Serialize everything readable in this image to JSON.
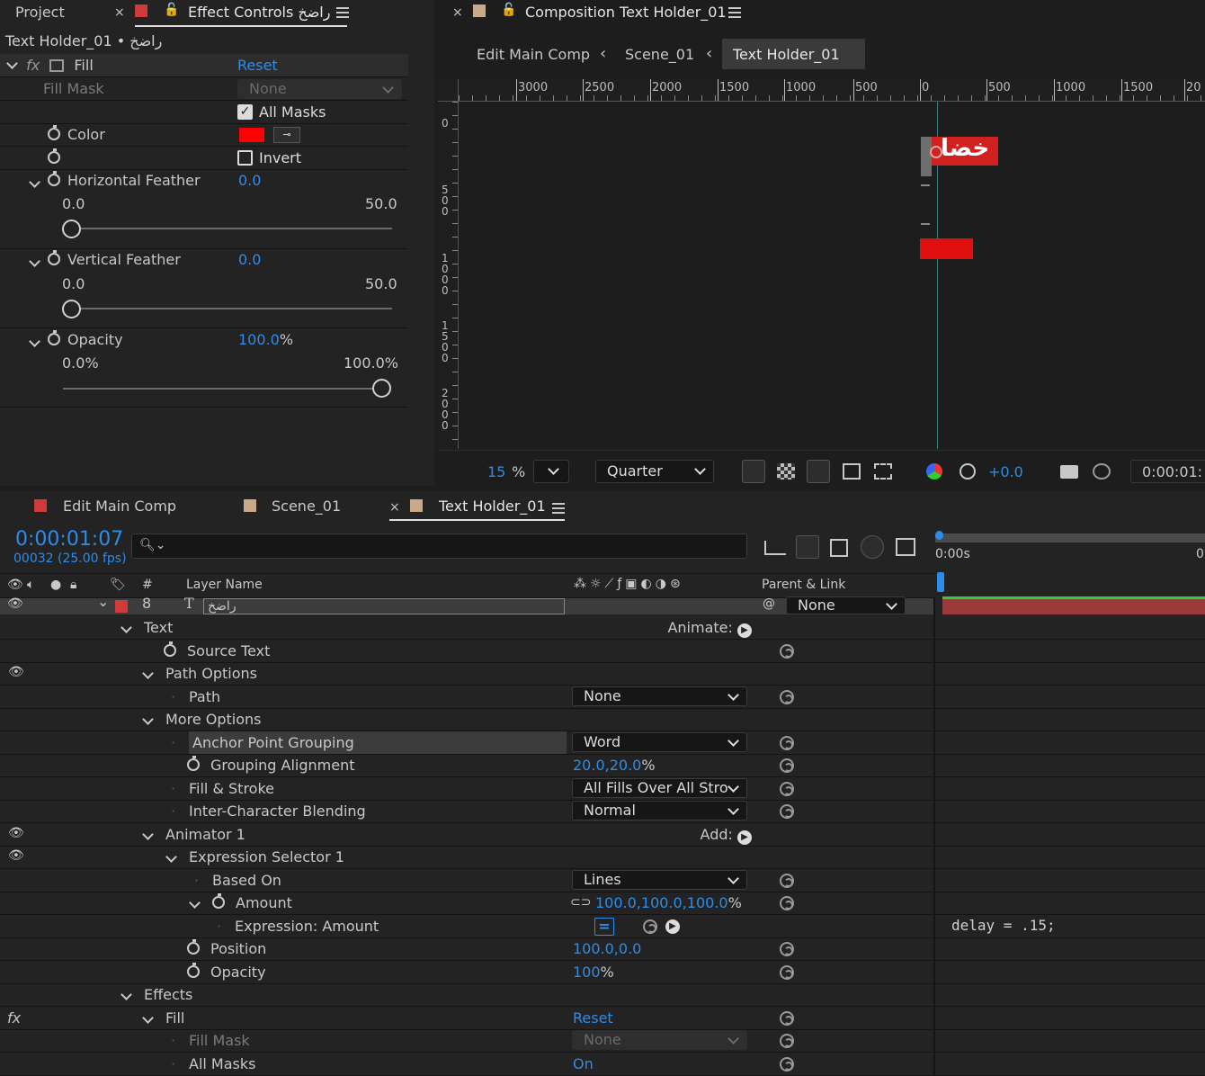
{
  "effect_controls": {
    "tabs": [
      {
        "label": "Project"
      },
      {
        "label": "Effect Controls راضخ"
      }
    ],
    "layer_label": "Text Holder_01 • راضخ",
    "effect": {
      "name": "Fill",
      "reset": "Reset"
    },
    "fill_mask": {
      "label": "Fill Mask",
      "value": "None"
    },
    "all_masks": {
      "label": "All Masks",
      "checked": true
    },
    "color": {
      "label": "Color",
      "value": "#ff0000"
    },
    "invert": {
      "label": "Invert",
      "checked": false
    },
    "horizontal_feather": {
      "label": "Horizontal Feather",
      "value": "0.0",
      "min": "0.0",
      "max": "50.0",
      "level": 0
    },
    "vertical_feather": {
      "label": "Vertical Feather",
      "value": "0.0",
      "min": "0.0",
      "max": "50.0",
      "level": 0
    },
    "opacity": {
      "label": "Opacity",
      "value": "100.0",
      "unit": "%",
      "min": "0.0%",
      "max": "100.0%",
      "level": 1
    }
  },
  "composition": {
    "tab": "Composition Text Holder_01",
    "breadcrumbs": [
      "Edit Main Comp",
      "Scene_01",
      "Text Holder_01"
    ],
    "ruler_h": [
      "3000",
      "2500",
      "2000",
      "1500",
      "1000",
      "500",
      "0",
      "500",
      "1000",
      "1500",
      "20"
    ],
    "ruler_v": [
      "0",
      "500",
      "1000",
      "1500",
      "2000"
    ],
    "zoom": "15",
    "zoom_unit": "%",
    "resolution": "Quarter",
    "exposure": "+0.0",
    "timecode": "0:00:01:",
    "canvas_text": "خضا"
  },
  "timeline": {
    "tabs": [
      {
        "label": "Edit Main Comp",
        "color": "#d03a3a"
      },
      {
        "label": "Scene_01",
        "color": "#c8a98a"
      },
      {
        "label": "Text Holder_01",
        "color": "#c8a98a"
      }
    ],
    "timecode": "0:00:01:07",
    "frame_info": "00032 (25.00 fps)",
    "columns": {
      "num": "#",
      "layer_name": "Layer Name",
      "parent": "Parent & Link"
    },
    "layer": {
      "number": "8",
      "name": "راضخ",
      "parent": "None"
    },
    "ruler_start": "0:00s",
    "ruler_end": "0",
    "expression_text": "delay = .15;",
    "rows": [
      {
        "label": "Text",
        "right": "Animate:"
      },
      {
        "label": "Source Text"
      },
      {
        "label": "Path Options"
      },
      {
        "label": "Path",
        "dd": "None"
      },
      {
        "label": "More Options"
      },
      {
        "label": "Anchor Point Grouping",
        "dd": "Word"
      },
      {
        "label": "Grouping Alignment",
        "value": "20.0,20.0",
        "unit": "%"
      },
      {
        "label": "Fill & Stroke",
        "dd": "All Fills Over All Stro"
      },
      {
        "label": "Inter-Character Blending",
        "dd": "Normal"
      },
      {
        "label": "Animator 1",
        "right": "Add:"
      },
      {
        "label": "Expression Selector 1"
      },
      {
        "label": "Based On",
        "dd": "Lines"
      },
      {
        "label": "Amount",
        "value": "100.0,100.0,100.0",
        "unit": "%"
      },
      {
        "label": "Expression: Amount"
      },
      {
        "label": "Position",
        "value": "100.0,0.0"
      },
      {
        "label": "Opacity",
        "value": "100",
        "unit": "%"
      },
      {
        "label": "Effects"
      },
      {
        "label": "Fill",
        "value": "Reset"
      },
      {
        "label": "Fill Mask",
        "dd": "None"
      },
      {
        "label": "All Masks",
        "value": "On"
      }
    ]
  }
}
